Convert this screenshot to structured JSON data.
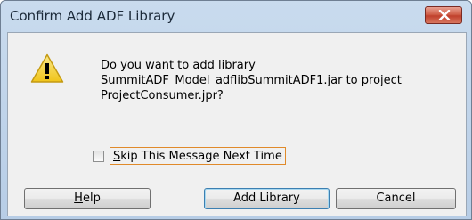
{
  "window": {
    "title": "Confirm Add ADF Library"
  },
  "message": {
    "line1": "Do you want to add library",
    "line2": "SummitADF_Model_adflibSummitADF1.jar to project",
    "line3": "ProjectConsumer.jpr?"
  },
  "skip_checkbox": {
    "label_mnemonic": "S",
    "label_rest": "kip This Message Next Time",
    "checked": false
  },
  "buttons": {
    "help_mnemonic": "H",
    "help_rest": "elp",
    "add_label": "Add Library",
    "cancel_label": "Cancel"
  },
  "icons": {
    "close": "close-icon",
    "warning": "warning-icon"
  },
  "colors": {
    "warning_fill": "#f5d22a",
    "close_button": "#c7452f",
    "focus_outline": "#e08a2a"
  }
}
